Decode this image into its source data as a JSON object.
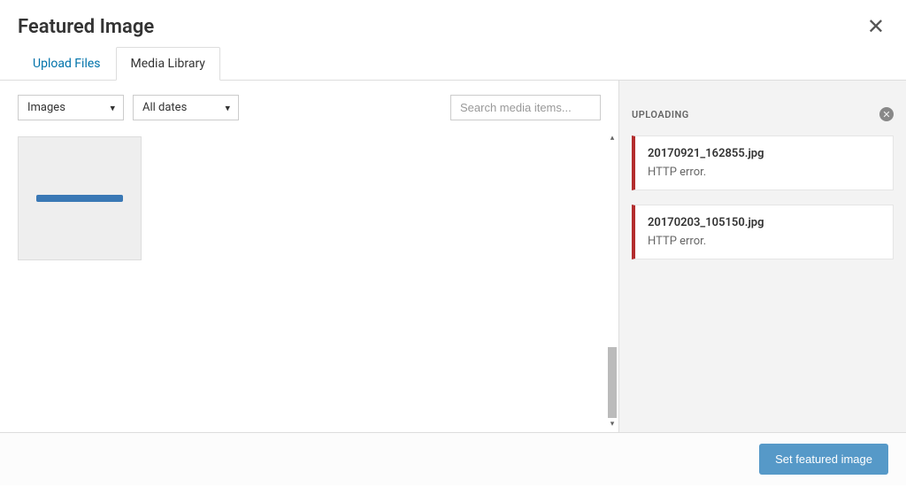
{
  "header": {
    "title": "Featured Image"
  },
  "tabs": {
    "upload_files": "Upload Files",
    "media_library": "Media Library"
  },
  "filters": {
    "type_selected": "Images",
    "date_selected": "All dates"
  },
  "search": {
    "placeholder": "Search media items..."
  },
  "sidebar": {
    "uploading_title": "UPLOADING",
    "uploads": [
      {
        "filename": "20170921_162855.jpg",
        "error": "HTTP error."
      },
      {
        "filename": "20170203_105150.jpg",
        "error": "HTTP error."
      }
    ]
  },
  "footer": {
    "set_featured_label": "Set featured image"
  }
}
